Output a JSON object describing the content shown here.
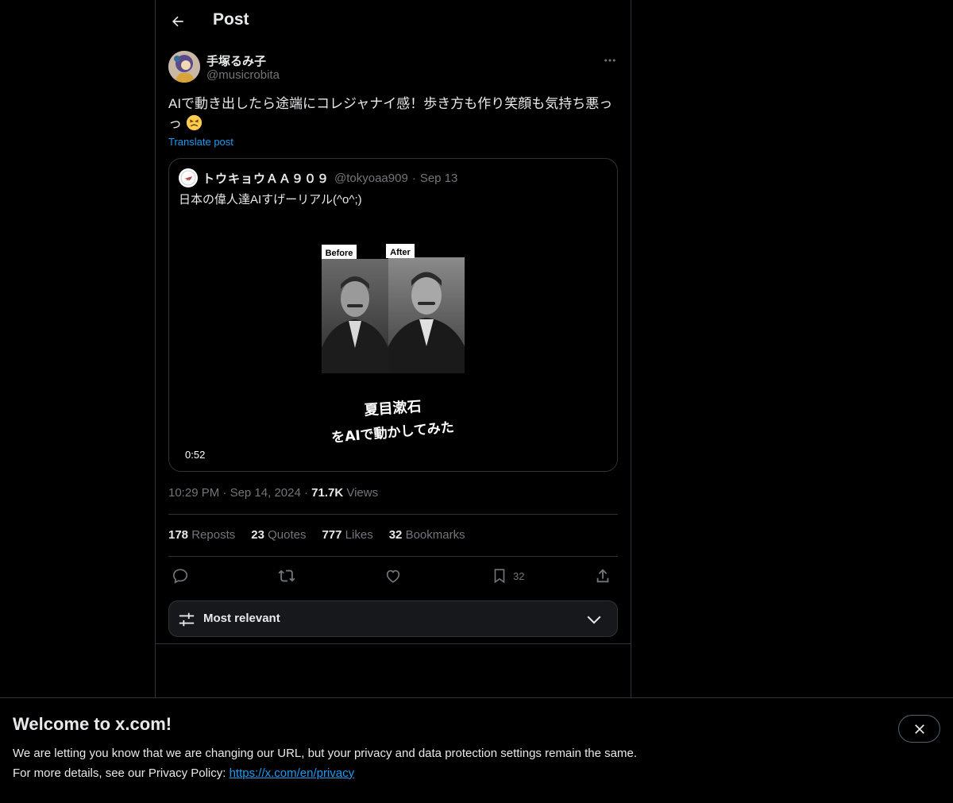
{
  "header": {
    "title": "Post"
  },
  "post": {
    "author_name": "手塚るみ子",
    "author_handle": "@musicrobita",
    "text": "AIで動き出したら途端にコレジャナイ感！歩き方も作り笑顔も気持ち悪っっ",
    "translate_label": "Translate post",
    "time": "10:29 PM",
    "date": "Sep 14, 2024",
    "views_count": "71.7K",
    "views_label": "Views"
  },
  "quote": {
    "author_name": "トウキョウＡＡ９０９",
    "author_handle": "@tokyoaa909",
    "date": "Sep 13",
    "text": "日本の偉人達AIすげーリアル(^o^;)",
    "video": {
      "label_before": "Before",
      "label_after": "After",
      "caption_line1": "夏目漱石",
      "caption_line2": "をAIで動かしてみた",
      "duration": "0:52"
    }
  },
  "stats": {
    "reposts_count": "178",
    "reposts_label": "Reposts",
    "quotes_count": "23",
    "quotes_label": "Quotes",
    "likes_count": "777",
    "likes_label": "Likes",
    "bookmarks_count": "32",
    "bookmarks_label": "Bookmarks"
  },
  "actions": {
    "bookmark_count": "32"
  },
  "sort": {
    "label": "Most relevant"
  },
  "banner": {
    "title": "Welcome to x.com!",
    "line1": "We are letting you know that we are changing our URL, but your privacy and data protection settings remain the same.",
    "line2_prefix": "For more details, see our Privacy Policy: ",
    "link": "https://x.com/en/privacy"
  },
  "colors": {
    "accent": "#1d9bf0",
    "muted": "#71767b",
    "text": "#e7e9ea",
    "border": "#2f3336"
  },
  "icons": [
    "back-arrow-icon",
    "more-icon",
    "reply-icon",
    "repost-icon",
    "like-icon",
    "bookmark-icon",
    "share-icon",
    "sort-sliders-icon",
    "chevron-down-icon",
    "close-icon"
  ]
}
